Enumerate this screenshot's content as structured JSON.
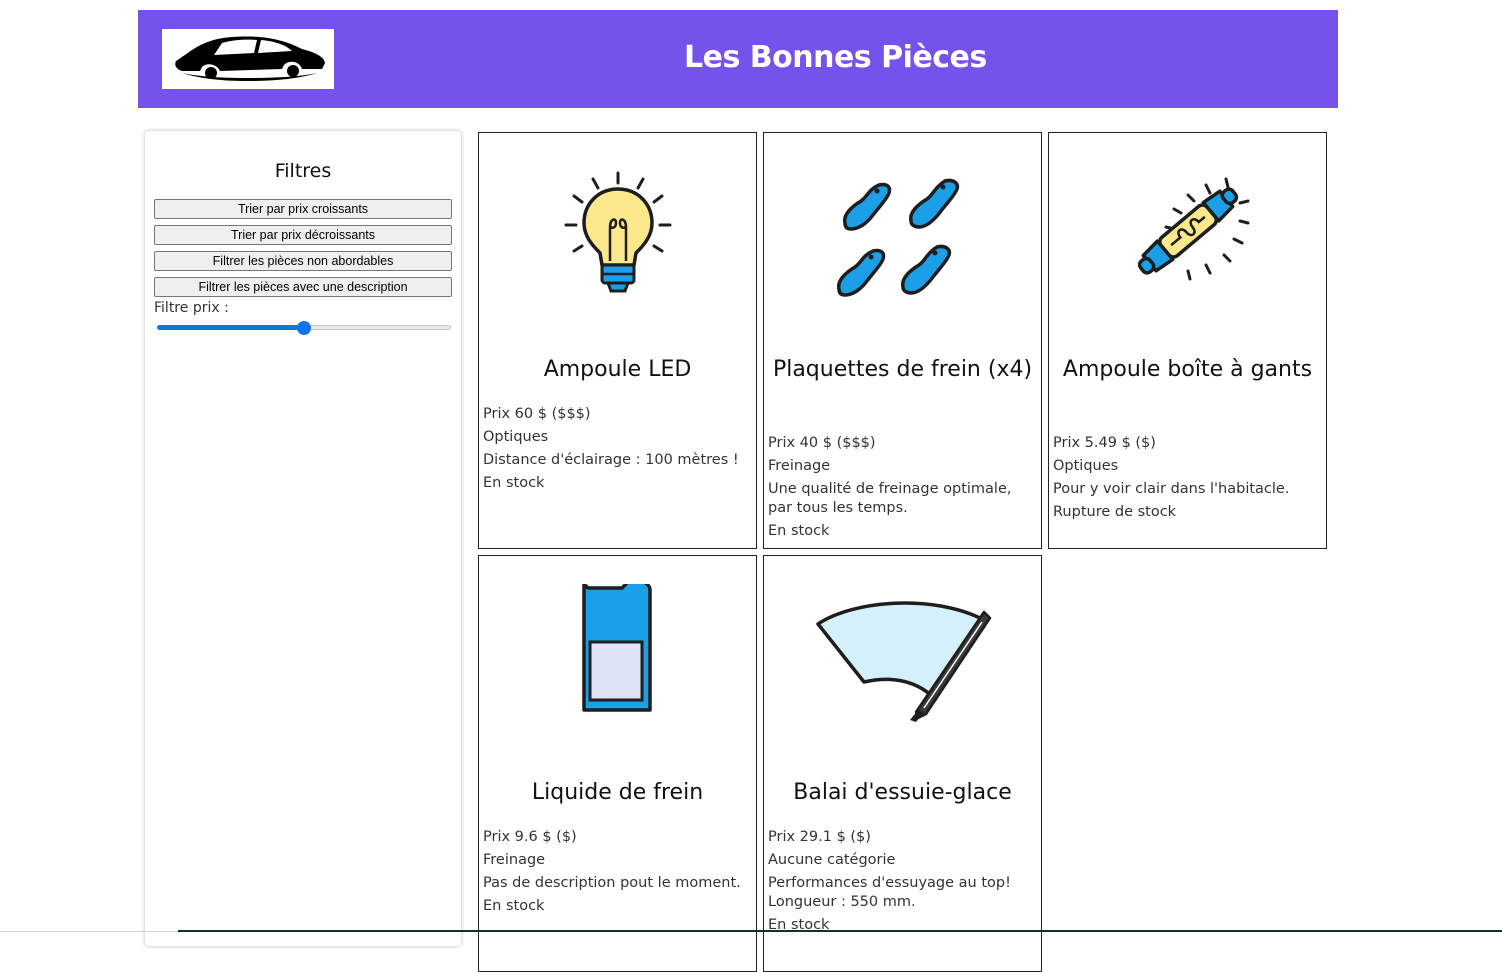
{
  "header": {
    "title": "Les Bonnes Pièces",
    "logo_icon": "car-silhouette-icon",
    "background_color": "#7652ec"
  },
  "filters": {
    "title": "Filtres",
    "buttons": [
      "Trier par prix croissants",
      "Trier par prix décroissants",
      "Filtrer les pièces non abordables",
      "Filtrer les pièces avec une description"
    ],
    "price_label": "Filtre prix :",
    "price_slider_fraction": 0.5,
    "slider_color": "#0e75e8"
  },
  "products": [
    {
      "name": "Ampoule LED",
      "icon": "light-bulb-icon",
      "price": "Prix 60 $ ($$$)",
      "category": "Optiques",
      "description": "Distance d'éclairage : 100 mètres !",
      "stock": "En stock"
    },
    {
      "name": "Plaquettes de frein (x4)",
      "icon": "brake-pads-icon",
      "price": "Prix 40 $ ($$$)",
      "category": "Freinage",
      "description": "Une qualité de freinage optimale, par tous les temps.",
      "stock": "En stock"
    },
    {
      "name": "Ampoule boîte à gants",
      "icon": "fuse-bulb-icon",
      "price": "Prix 5.49 $ ($)",
      "category": "Optiques",
      "description": "Pour y voir clair dans l'habitacle.",
      "stock": "Rupture de stock"
    },
    {
      "name": "Liquide de frein",
      "icon": "fluid-can-icon",
      "price": "Prix 9.6 $ ($)",
      "category": "Freinage",
      "description": "Pas de description pout le moment.",
      "stock": "En stock"
    },
    {
      "name": "Balai d'essuie-glace",
      "icon": "wiper-blade-icon",
      "price": "Prix 29.1 $ ($)",
      "category": "Aucune catégorie",
      "description": "Performances d'essuyage au top! Longueur : 550 mm.",
      "stock": "En stock"
    }
  ]
}
